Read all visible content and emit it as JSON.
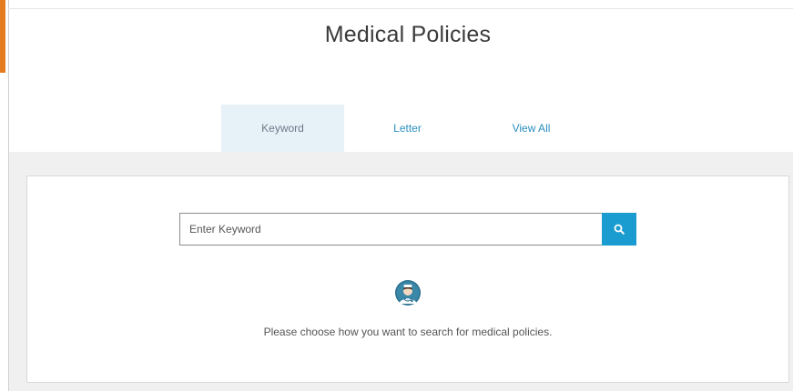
{
  "header": {
    "title": "Medical Policies"
  },
  "tabs": [
    {
      "label": "Keyword",
      "active": true
    },
    {
      "label": "Letter",
      "active": false
    },
    {
      "label": "View All",
      "active": false
    }
  ],
  "search": {
    "value": "",
    "placeholder": "Enter Keyword",
    "button_icon": "search-icon"
  },
  "illustration": {
    "icon": "doctor-avatar-icon"
  },
  "hint": {
    "text": "Please choose how you want to search for medical policies."
  },
  "colors": {
    "accent_orange": "#e57c20",
    "link_blue": "#2a8fc0",
    "button_blue": "#1a9cd0",
    "active_tab_bg": "#e6f1f8",
    "panel_bg": "#f0f0f0"
  }
}
